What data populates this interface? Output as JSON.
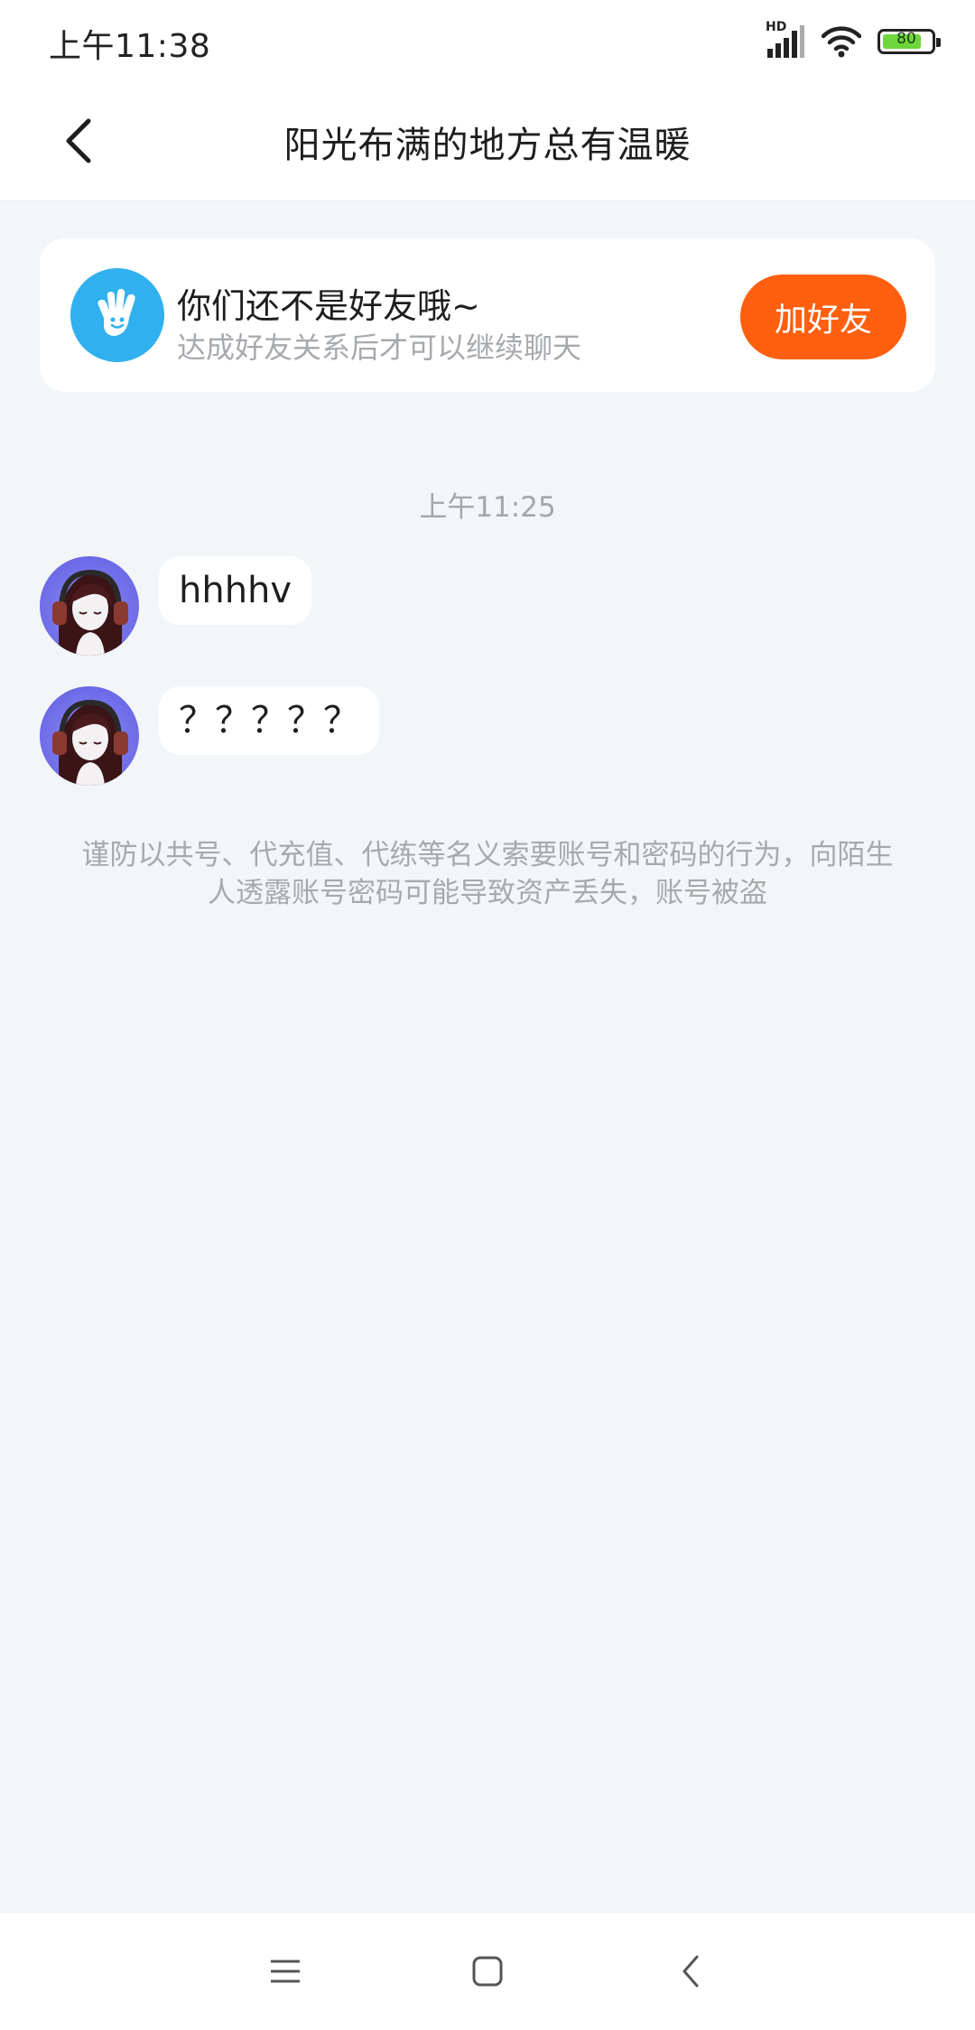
{
  "status_bar": {
    "time": "上午11:38",
    "network_badge": "HD",
    "battery_level": "80",
    "battery_fraction": 0.8,
    "icons": [
      "signal-icon",
      "wifi-icon",
      "battery-icon"
    ]
  },
  "header": {
    "title": "阳光布满的地方总有温暖",
    "back_icon": "back-chevron-icon"
  },
  "friend_card": {
    "title": "你们还不是好友哦~",
    "subtitle": "达成好友关系后才可以继续聊天",
    "button_label": "加好友",
    "button_color": "#ff5f0f",
    "icon": "waving-hand-icon",
    "icon_bg_color": "#31b0ef"
  },
  "chat": {
    "timestamp": "上午11:25",
    "messages": [
      {
        "text": "hhhhv"
      },
      {
        "text": "？？？？？"
      }
    ]
  },
  "warning": {
    "text": "谨防以共号、代充值、代练等名义索要账号和密码的行为，向陌生人透露账号密码可能导致资产丢失，账号被盗"
  },
  "nav_bar": {
    "icons": [
      "menu-icon",
      "home-icon",
      "back-icon"
    ]
  }
}
